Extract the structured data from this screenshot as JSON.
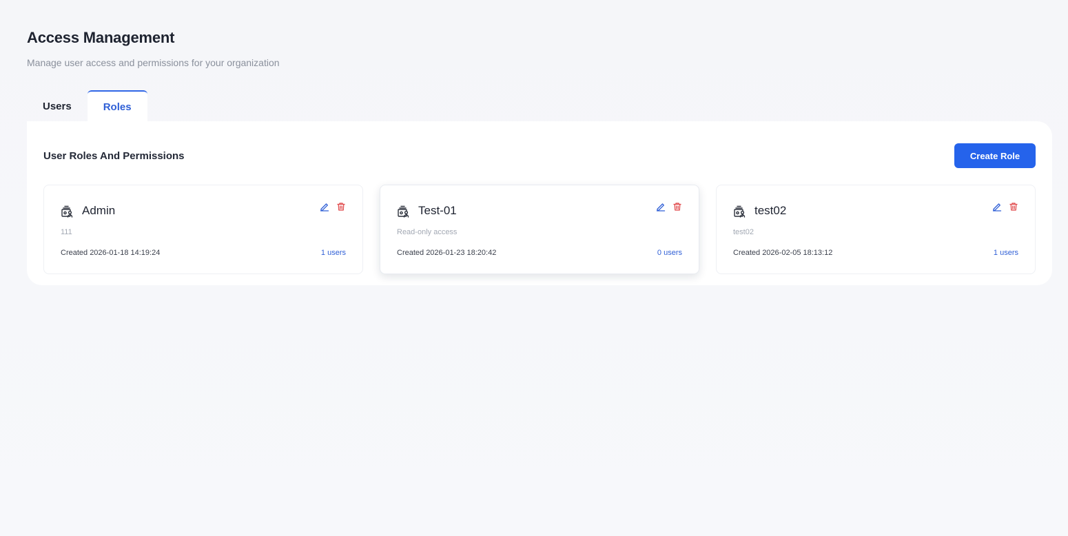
{
  "header": {
    "title": "Access Management",
    "subtitle": "Manage user access and permissions for your organization"
  },
  "tabs": [
    {
      "label": "Users",
      "active": false
    },
    {
      "label": "Roles",
      "active": true
    }
  ],
  "panel": {
    "title": "User Roles And Permissions",
    "create_label": "Create Role"
  },
  "roles": [
    {
      "name": "Admin",
      "description": "111",
      "created": "Created 2026-01-18 14:19:24",
      "users": "1 users"
    },
    {
      "name": "Test-01",
      "description": "Read-only access",
      "created": "Created 2026-01-23 18:20:42",
      "users": "0 users"
    },
    {
      "name": "test02",
      "description": "test02",
      "created": "Created 2026-02-05 18:13:12",
      "users": "1 users"
    }
  ],
  "icons": {
    "role": "user-role-icon",
    "edit": "pencil-icon",
    "delete": "trash-icon"
  },
  "colors": {
    "accent": "#2563eb",
    "active_tab_text": "#2f5fd6",
    "delete": "#e0484a"
  }
}
